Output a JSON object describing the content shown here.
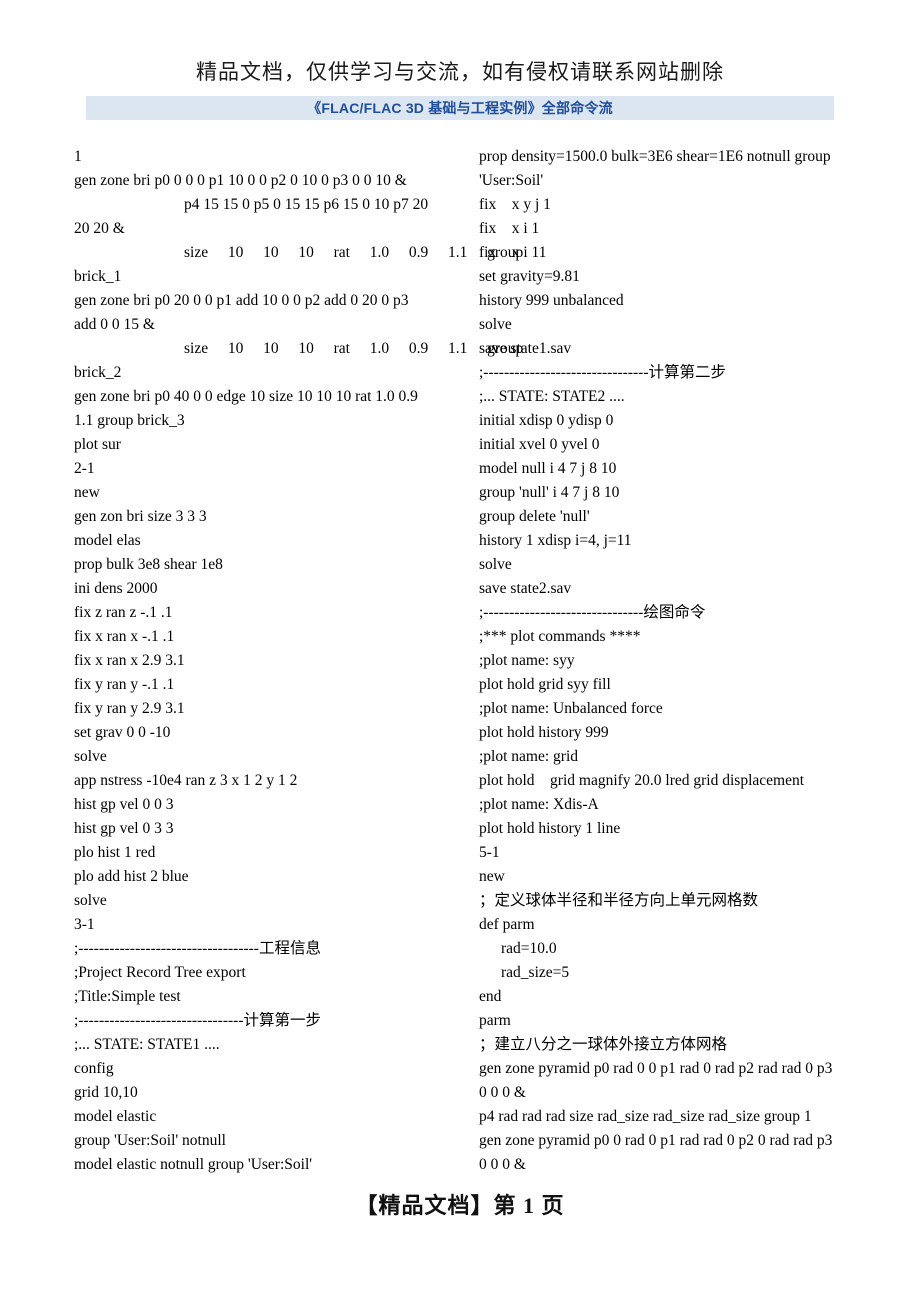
{
  "header": {
    "watermark": "精品文档，仅供学习与交流，如有侵权请联系网站删除",
    "title": "《FLAC/FLAC 3D 基础与工程实例》全部命令流",
    "title_color": "#1f4e9c",
    "banner_bg": "#dce6f0"
  },
  "footer": {
    "text": "【精品文档】第 1 页",
    "page_number": "1"
  },
  "left_column": {
    "lines": [
      "1",
      "gen zone bri p0 0 0 0 p1 10 0 0 p2 0 10 0 p3 0 0 10 &",
      "p4 15 15 0 p5 0 15 15 p6 15 0 10 p7 20",
      "20 20 &",
      "size  10  10  10  rat  1.0  0.9  1.1  group",
      "brick_1",
      "gen zone bri p0 20 0 0 p1 add 10 0 0 p2 add 0 20 0 p3",
      "add 0 0 15 &",
      "size  10  10  10  rat  1.0  0.9  1.1  group",
      "brick_2",
      "gen zone bri p0 40 0 0 edge 10 size 10 10 10 rat 1.0 0.9",
      "1.1 group brick_3",
      "plot sur",
      "2-1",
      "new",
      "gen zon bri size 3 3 3",
      "model elas",
      "prop bulk 3e8 shear 1e8",
      "ini dens 2000",
      "fix z ran z -.1 .1",
      "fix x ran x -.1 .1",
      "fix x ran x 2.9 3.1",
      "fix y ran y -.1 .1",
      "fix y ran y 2.9 3.1",
      "set grav 0 0 -10",
      "solve",
      "app nstress -10e4 ran z 3 x 1 2 y 1 2",
      "hist gp vel 0 0 3",
      "hist gp vel 0 3 3",
      "plo hist 1 red",
      "plo add hist 2 blue",
      "solve",
      "3-1",
      ";-----------------------------------工程信息",
      ";Project Record Tree export",
      ";Title:Simple test",
      ";--------------------------------计算第一步",
      ";... STATE: STATE1 ....",
      "config",
      "grid 10,10",
      "model elastic",
      "group 'User:Soil' notnull",
      "model elastic notnull group 'User:Soil'"
    ]
  },
  "right_column": {
    "lines": [
      "prop density=1500.0 bulk=3E6 shear=1E6 notnull group",
      "'User:Soil'",
      "fix    x y j 1",
      "fix    x i 1",
      "fix    x i 11",
      "set gravity=9.81",
      "history 999 unbalanced",
      "solve",
      "save state1.sav",
      ";--------------------------------计算第二步",
      ";... STATE: STATE2 ....",
      "initial xdisp 0 ydisp 0",
      "initial xvel 0 yvel 0",
      "model null i 4 7 j 8 10",
      "group 'null' i 4 7 j 8 10",
      "group delete 'null'",
      "history 1 xdisp i=4, j=11",
      "solve",
      "save state2.sav",
      ";-------------------------------绘图命令",
      ";*** plot commands ****",
      ";plot name: syy",
      "plot hold grid syy fill",
      ";plot name: Unbalanced force",
      "plot hold history 999",
      ";plot name: grid",
      "plot hold    grid magnify 20.0 lred grid displacement",
      ";plot name: Xdis-A",
      "plot hold history 1 line",
      "5-1",
      "new",
      "；定义球体半径和半径方向上单元网格数",
      "def parm",
      "rad=10.0",
      "rad_size=5",
      "end",
      "parm",
      "；建立八分之一球体外接立方体网格",
      "gen zone pyramid p0 rad 0 0 p1 rad 0 rad p2 rad rad 0 p3",
      "0 0 0 &",
      "p4 rad rad rad size rad_size rad_size rad_size group 1",
      "gen zone pyramid p0 0 rad 0 p1 rad rad 0 p2 0 rad rad p3",
      "0 0 0 &"
    ]
  }
}
